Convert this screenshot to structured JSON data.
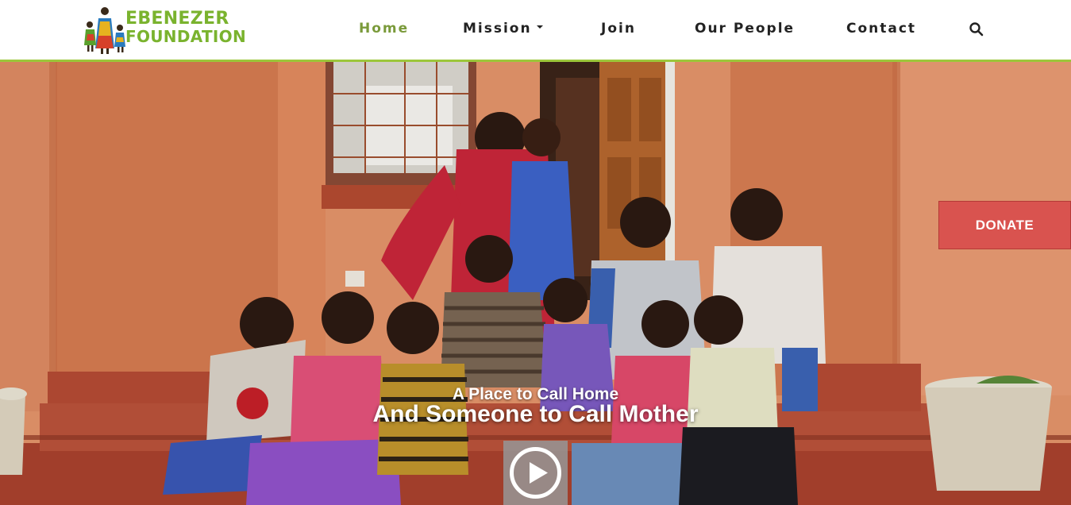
{
  "brand": {
    "line1": "EBENEZER",
    "line2": "FOUNDATION",
    "green": "#7ab32e"
  },
  "nav": {
    "items": [
      {
        "label": "Home",
        "active": true
      },
      {
        "label": "Mission",
        "dropdown": true
      },
      {
        "label": "Join"
      },
      {
        "label": "Our People"
      },
      {
        "label": "Contact"
      }
    ],
    "search_icon": "search-icon",
    "active_color": "#7a9a3a"
  },
  "hero": {
    "tagline_small": "A Place to Call Home",
    "tagline_large": "And Someone to Call Mother",
    "play_icon": "play-icon"
  },
  "donate": {
    "label": "DONATE",
    "color": "#d9534f"
  }
}
